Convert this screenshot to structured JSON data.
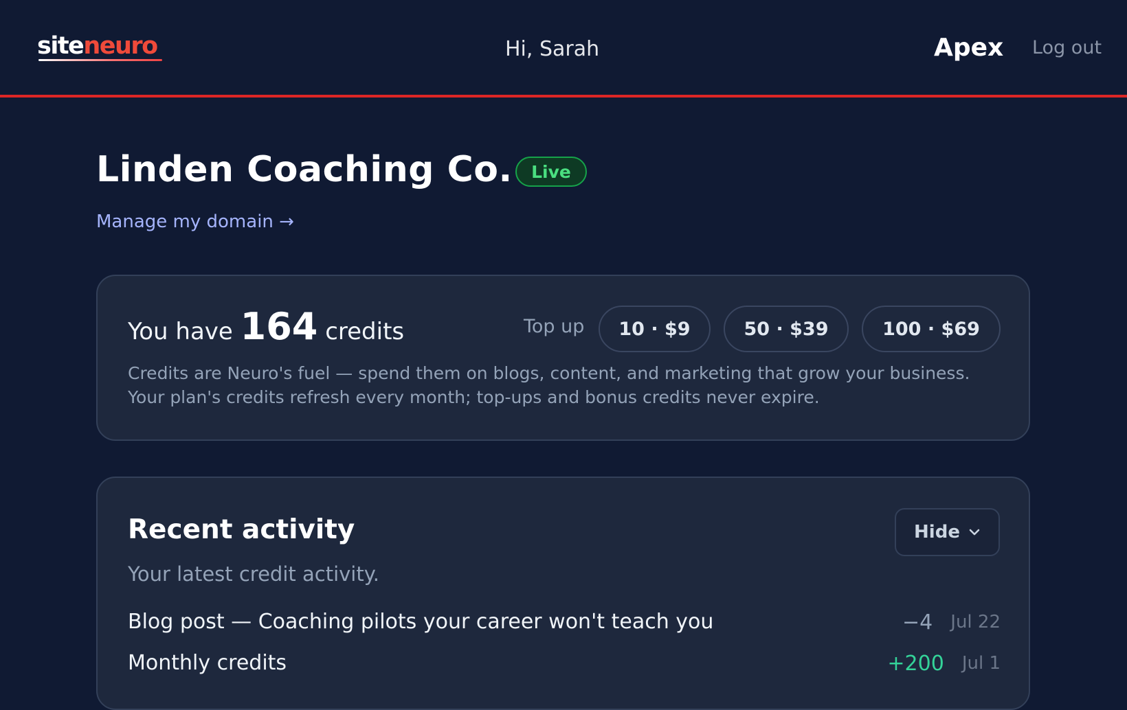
{
  "header": {
    "logo_site": "site",
    "logo_neuro": "neuro",
    "greeting": "Hi, Sarah",
    "plan": "Apex",
    "logout": "Log out",
    "accent_color": "#dc2626"
  },
  "site": {
    "name": "Linden Coaching Co.",
    "status": "Live",
    "manage_domain": "Manage my domain →"
  },
  "credits": {
    "prefix": "You have",
    "count": "164",
    "suffix": "credits",
    "topup_label": "Top up",
    "options": [
      "10 · $9",
      "50 · $39",
      "100 · $69"
    ],
    "description_1": "Credits are Neuro's fuel — spend them on blogs, content, and marketing that grow your business.",
    "description_2": "Your plan's credits refresh every month; top-ups and bonus credits never expire."
  },
  "activity": {
    "title": "Recent activity",
    "toggle": "Hide",
    "subtitle": "Your latest credit activity.",
    "items": [
      {
        "label": "Blog post — Coaching pilots your career won't teach you",
        "amount": "−4",
        "date": "Jul 22"
      },
      {
        "label": "Monthly credits",
        "amount": "+200",
        "date": "Jul 1"
      }
    ]
  }
}
